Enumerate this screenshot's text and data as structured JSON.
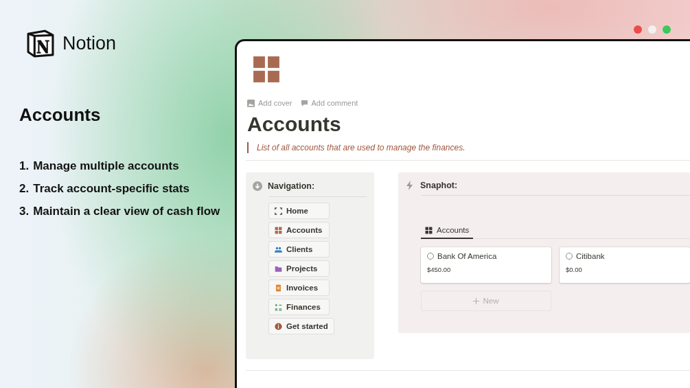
{
  "brand": {
    "name": "Notion"
  },
  "promo": {
    "heading": "Accounts",
    "points": [
      {
        "number": "1.",
        "text": "Manage multiple accounts"
      },
      {
        "number": "2.",
        "text": "Track account-specific stats"
      },
      {
        "number": "3.",
        "text": "Maintain a clear view of cash flow"
      }
    ]
  },
  "page": {
    "actions": [
      "Add cover",
      "Add comment"
    ],
    "title": "Accounts",
    "quote": "List of all accounts that are used to manage the finances.",
    "navigation": {
      "heading": "Navigation:",
      "items": [
        "Home",
        "Accounts",
        "Clients",
        "Projects",
        "Invoices",
        "Finances",
        "Get started"
      ]
    },
    "snapshot": {
      "heading": "Snaphot:",
      "tabs": [
        {
          "label": "Accounts",
          "selected": true
        }
      ],
      "cards": [
        {
          "name": "Bank Of America",
          "amount": "$450.00",
          "checked": false
        },
        {
          "name": "Citibank",
          "amount": "$0.00",
          "checked": false
        }
      ],
      "new_button": "New"
    }
  }
}
